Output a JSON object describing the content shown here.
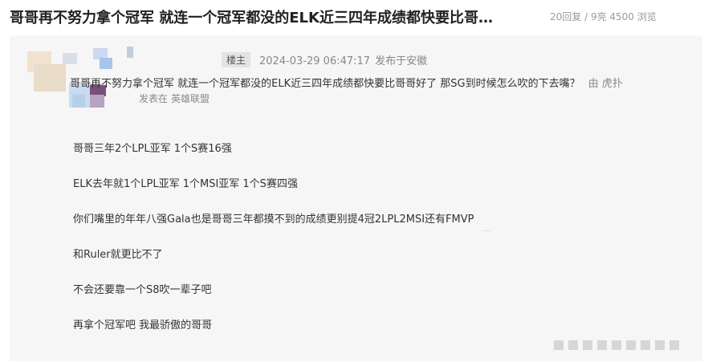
{
  "thread": {
    "title": "哥哥再不努力拿个冠军 就连一个冠军都没的ELK近三四年成绩都快要比哥…",
    "stats": "20回复 / 9亮 4500 浏览"
  },
  "post": {
    "badge": "楼主",
    "timestamp": "2024-03-29 06:47:17",
    "location": "发布于安徽",
    "quote": "哥哥再不努力拿个冠军 就连一个冠军都没的ELK近三四年成绩都快要比哥哥好了 那SG到时候怎么吹的下去嘴？",
    "quote_author": "由 虎扑",
    "posted_in_label": "发表在",
    "board": "英雄联盟",
    "lines": [
      "哥哥三年2个LPL亚军 1个S赛16强",
      "ELK去年就1个LPL亚军 1个MSI亚军 1个S赛四强",
      "你们嘴里的年年八强Gala也是哥哥三年都摸不到的成绩更别提4冠2LPL2MSI还有FMVP",
      "和Ruler就更比不了",
      "不会还要靠一个S8吹一辈子吧",
      "再拿个冠军吧 我最骄傲的哥哥"
    ]
  },
  "colors": {
    "card_bg": "#f6f6f6",
    "muted_text": "#888888",
    "title_text": "#222222"
  },
  "icons": {
    "avatar": "blurred-avatar-mosaic"
  }
}
